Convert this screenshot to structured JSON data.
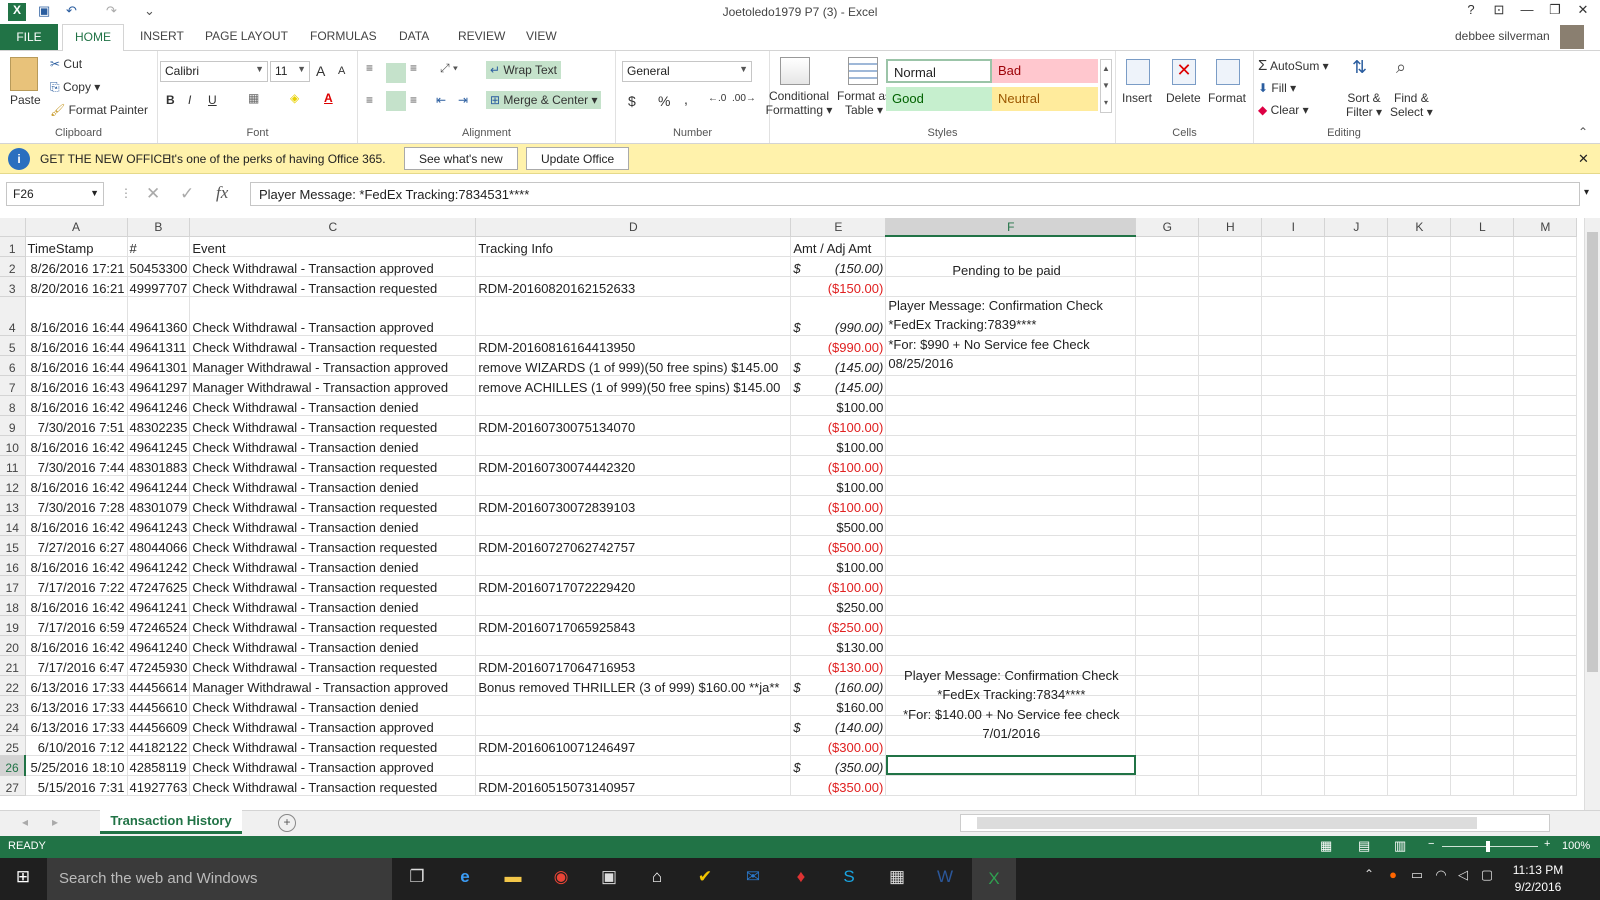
{
  "window": {
    "title": "Joetoledo1979 P7 (3) - Excel",
    "help": "?",
    "min": "—",
    "restore": "❐",
    "close": "✕"
  },
  "qat": {
    "excel_icon": "X",
    "save_icon": "💾",
    "undo_icon": "↶",
    "redo_icon": "↷",
    "customize_icon": "⌄"
  },
  "tabs": {
    "file": "FILE",
    "home": "HOME",
    "insert": "INSERT",
    "page_layout": "PAGE LAYOUT",
    "formulas": "FORMULAS",
    "data": "DATA",
    "review": "REVIEW",
    "view": "VIEW"
  },
  "user": {
    "name": "debbee silverman"
  },
  "ribbon": {
    "clipboard": {
      "label": "Clipboard",
      "paste": "Paste",
      "cut": "Cut",
      "copy": "Copy",
      "format_painter": "Format Painter"
    },
    "font": {
      "label": "Font",
      "name": "Calibri",
      "size": "11",
      "bold": "B",
      "italic": "I",
      "underline": "U",
      "grow": "A",
      "shrink": "A"
    },
    "alignment": {
      "label": "Alignment",
      "wrap_text": "Wrap Text",
      "merge_center": "Merge & Center"
    },
    "number": {
      "label": "Number",
      "format": "General",
      "currency": "$",
      "percent": "%",
      "comma": ","
    },
    "styles": {
      "label": "Styles",
      "conditional": "Conditional",
      "conditional2": "Formatting",
      "format_as": "Format as",
      "format_as2": "Table",
      "normal": "Normal",
      "bad": "Bad",
      "good": "Good",
      "neutral": "Neutral"
    },
    "cells": {
      "label": "Cells",
      "insert": "Insert",
      "delete": "Delete",
      "format": "Format"
    },
    "editing": {
      "label": "Editing",
      "autosum": "AutoSum",
      "fill": "Fill",
      "clear": "Clear",
      "sort": "Sort &",
      "sort2": "Filter",
      "find": "Find &",
      "find2": "Select"
    }
  },
  "message_bar": {
    "title": "GET THE NEW OFFICE",
    "text": "It's one of the perks of having Office 365.",
    "btn1": "See what's new",
    "btn2": "Update Office",
    "close": "✕"
  },
  "formula_bar": {
    "name_box": "F26",
    "fx": "fx",
    "formula": "Player Message: *FedEx Tracking:7834531****"
  },
  "columns": [
    "A",
    "B",
    "C",
    "D",
    "E",
    "F",
    "G",
    "H",
    "I",
    "J",
    "K",
    "L",
    "M"
  ],
  "rows": [
    {
      "n": "1",
      "a": "TimeStamp",
      "b": "#",
      "c": "Event",
      "d": "Tracking Info",
      "e": "Amt / Adj Amt",
      "t": "hdr"
    },
    {
      "n": "2",
      "a": "8/26/2016 17:21",
      "b": "50453300",
      "c": "Check Withdrawal - Transaction approved",
      "d": "",
      "e": "(150.00)",
      "t": "acct"
    },
    {
      "n": "3",
      "a": "8/20/2016 16:21",
      "b": "49997707",
      "c": "Check Withdrawal - Transaction requested",
      "d": "RDM-20160820162152633",
      "e": "($150.00)",
      "t": "neg"
    },
    {
      "n": "4",
      "a": "8/16/2016 16:44",
      "b": "49641360",
      "c": "Check Withdrawal - Transaction approved",
      "d": "",
      "e": "(990.00)",
      "t": "acct"
    },
    {
      "n": "5",
      "a": "8/16/2016 16:44",
      "b": "49641311",
      "c": "Check Withdrawal - Transaction requested",
      "d": "RDM-20160816164413950",
      "e": "($990.00)",
      "t": "neg"
    },
    {
      "n": "6",
      "a": "8/16/2016 16:44",
      "b": "49641301",
      "c": "Manager Withdrawal - Transaction approved",
      "d": "remove WIZARDS (1 of 999)(50 free spins) $145.00",
      "e": "(145.00)",
      "t": "acct"
    },
    {
      "n": "7",
      "a": "8/16/2016 16:43",
      "b": "49641297",
      "c": "Manager Withdrawal - Transaction approved",
      "d": "remove ACHILLES (1 of 999)(50 free spins) $145.00",
      "e": "(145.00)",
      "t": "acct"
    },
    {
      "n": "8",
      "a": "8/16/2016 16:42",
      "b": "49641246",
      "c": "Check Withdrawal - Transaction denied",
      "d": "",
      "e": "$100.00",
      "t": "pos"
    },
    {
      "n": "9",
      "a": "7/30/2016 7:51",
      "b": "48302235",
      "c": "Check Withdrawal - Transaction requested",
      "d": "RDM-20160730075134070",
      "e": "($100.00)",
      "t": "neg"
    },
    {
      "n": "10",
      "a": "8/16/2016 16:42",
      "b": "49641245",
      "c": "Check Withdrawal - Transaction denied",
      "d": "",
      "e": "$100.00",
      "t": "pos"
    },
    {
      "n": "11",
      "a": "7/30/2016 7:44",
      "b": "48301883",
      "c": "Check Withdrawal - Transaction requested",
      "d": "RDM-20160730074442320",
      "e": "($100.00)",
      "t": "neg"
    },
    {
      "n": "12",
      "a": "8/16/2016 16:42",
      "b": "49641244",
      "c": "Check Withdrawal - Transaction denied",
      "d": "",
      "e": "$100.00",
      "t": "pos"
    },
    {
      "n": "13",
      "a": "7/30/2016 7:28",
      "b": "48301079",
      "c": "Check Withdrawal - Transaction requested",
      "d": "RDM-20160730072839103",
      "e": "($100.00)",
      "t": "neg"
    },
    {
      "n": "14",
      "a": "8/16/2016 16:42",
      "b": "49641243",
      "c": "Check Withdrawal - Transaction denied",
      "d": "",
      "e": "$500.00",
      "t": "pos"
    },
    {
      "n": "15",
      "a": "7/27/2016 6:27",
      "b": "48044066",
      "c": "Check Withdrawal - Transaction requested",
      "d": "RDM-20160727062742757",
      "e": "($500.00)",
      "t": "neg"
    },
    {
      "n": "16",
      "a": "8/16/2016 16:42",
      "b": "49641242",
      "c": "Check Withdrawal - Transaction denied",
      "d": "",
      "e": "$100.00",
      "t": "pos"
    },
    {
      "n": "17",
      "a": "7/17/2016 7:22",
      "b": "47247625",
      "c": "Check Withdrawal - Transaction requested",
      "d": "RDM-20160717072229420",
      "e": "($100.00)",
      "t": "neg"
    },
    {
      "n": "18",
      "a": "8/16/2016 16:42",
      "b": "49641241",
      "c": "Check Withdrawal - Transaction denied",
      "d": "",
      "e": "$250.00",
      "t": "pos"
    },
    {
      "n": "19",
      "a": "7/17/2016 6:59",
      "b": "47246524",
      "c": "Check Withdrawal - Transaction requested",
      "d": "RDM-20160717065925843",
      "e": "($250.00)",
      "t": "neg"
    },
    {
      "n": "20",
      "a": "8/16/2016 16:42",
      "b": "49641240",
      "c": "Check Withdrawal - Transaction denied",
      "d": "",
      "e": "$130.00",
      "t": "pos"
    },
    {
      "n": "21",
      "a": "7/17/2016 6:47",
      "b": "47245930",
      "c": "Check Withdrawal - Transaction requested",
      "d": "RDM-20160717064716953",
      "e": "($130.00)",
      "t": "neg"
    },
    {
      "n": "22",
      "a": "6/13/2016 17:33",
      "b": "44456614",
      "c": "Manager Withdrawal - Transaction approved",
      "d": "Bonus removed THRILLER (3 of 999) $160.00 **ja**",
      "e": "(160.00)",
      "t": "acct"
    },
    {
      "n": "23",
      "a": "6/13/2016 17:33",
      "b": "44456610",
      "c": "Check Withdrawal - Transaction denied",
      "d": "",
      "e": "$160.00",
      "t": "pos"
    },
    {
      "n": "24",
      "a": "6/13/2016 17:33",
      "b": "44456609",
      "c": "Check Withdrawal - Transaction approved",
      "d": "",
      "e": "(140.00)",
      "t": "acct"
    },
    {
      "n": "25",
      "a": "6/10/2016 7:12",
      "b": "44182122",
      "c": "Check Withdrawal - Transaction requested",
      "d": "RDM-20160610071246497",
      "e": "($300.00)",
      "t": "neg"
    },
    {
      "n": "26",
      "a": "5/25/2016 18:10",
      "b": "42858119",
      "c": "Check Withdrawal - Transaction approved",
      "d": "",
      "e": "(350.00)",
      "t": "acct"
    },
    {
      "n": "27",
      "a": "5/15/2016 7:31",
      "b": "41927763",
      "c": "Check Withdrawal - Transaction requested",
      "d": "RDM-20160515073140957",
      "e": "($350.00)",
      "t": "neg"
    }
  ],
  "dollar": "$",
  "notes": {
    "pending": "Pending to be paid",
    "msg1": [
      "Player Message: Confirmation Check",
      "*FedEx Tracking:7839****",
      "*For: $990 + No Service fee Check",
      "08/25/2016"
    ],
    "msg2": [
      "Player Message: Confirmation Check",
      "*FedEx Tracking:7834****",
      "*For: $140.00 + No Service fee check",
      "7/01/2016"
    ]
  },
  "sheet": {
    "tab": "Transaction History",
    "add": "+"
  },
  "status": {
    "ready": "READY",
    "zoom": "100%",
    "zoom_minus": "−",
    "zoom_plus": "+"
  },
  "taskbar": {
    "search": "Search the web and Windows",
    "time": "11:13 PM",
    "date": "9/2/2016"
  }
}
